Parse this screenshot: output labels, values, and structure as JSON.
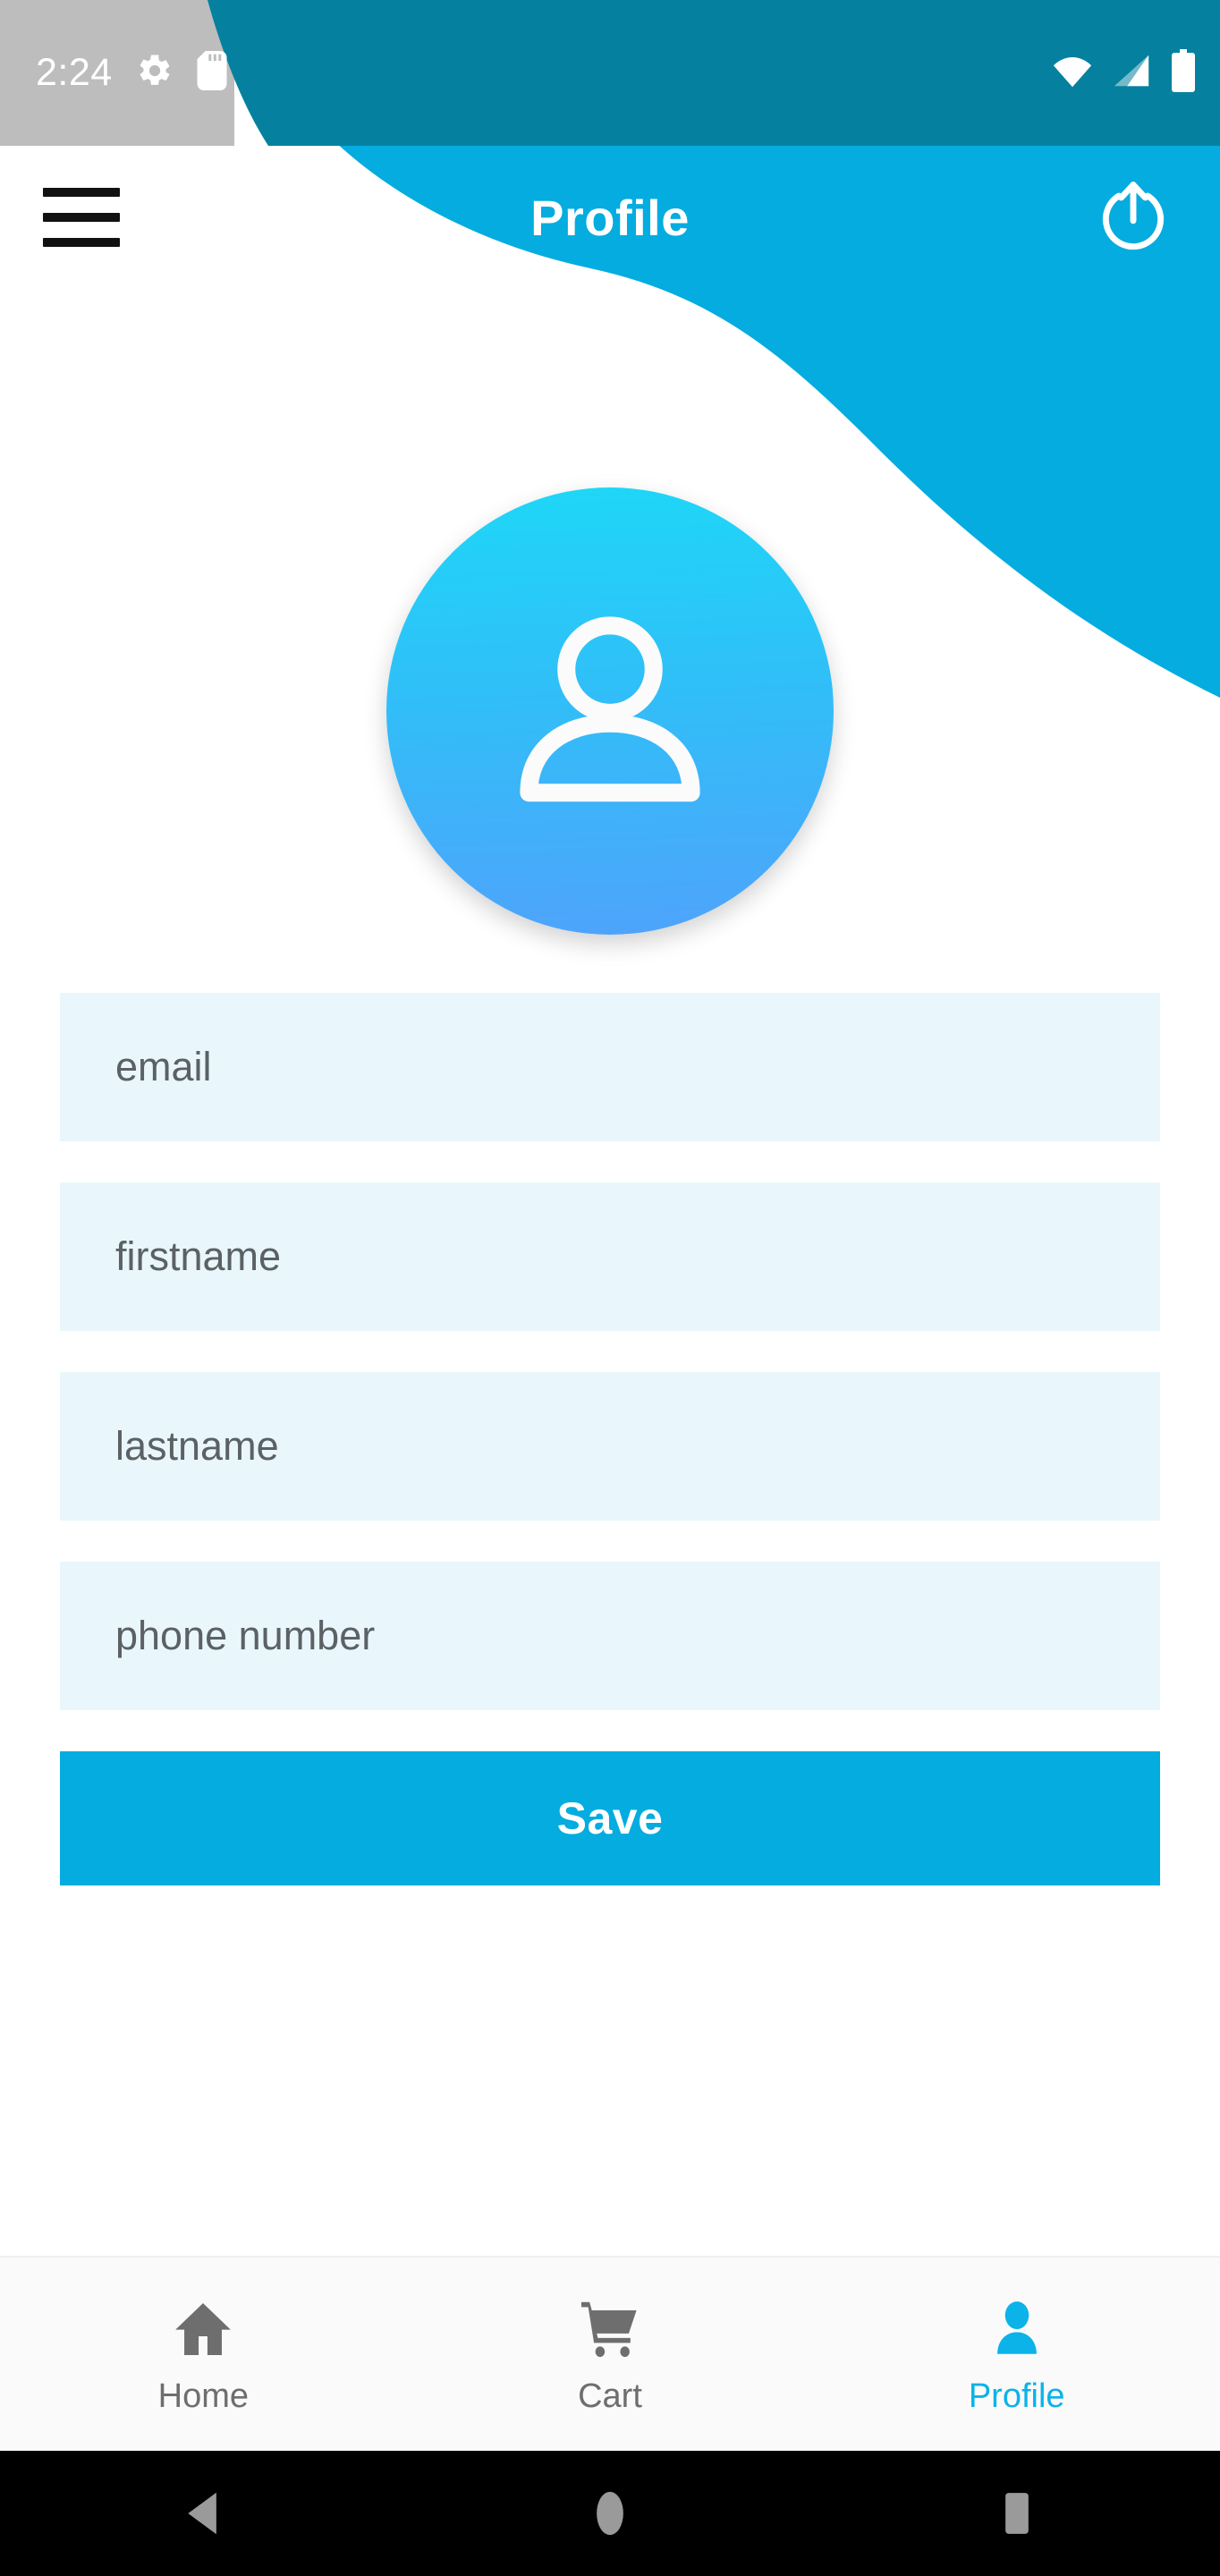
{
  "status_bar": {
    "time": "2:24",
    "left_icons": [
      "settings-gear-icon",
      "sd-card-icon"
    ],
    "right_icons": [
      "wifi-icon",
      "cellular-signal-icon",
      "battery-icon"
    ],
    "background_color": "#BDBDBD",
    "overlay_color": "#05819F"
  },
  "app_bar": {
    "menu_icon": "hamburger-menu-icon",
    "title": "Profile",
    "action_icon": "logout-icon",
    "background_color": "#04ACE0",
    "title_color": "#FFFFFF"
  },
  "avatar": {
    "icon": "user-person-icon",
    "gradient_start": "#1ED7F7",
    "gradient_end": "#4FA3FB"
  },
  "form": {
    "fields": [
      {
        "name": "email",
        "placeholder": "email",
        "value": ""
      },
      {
        "name": "firstname",
        "placeholder": "firstname",
        "value": ""
      },
      {
        "name": "lastname",
        "placeholder": "lastname",
        "value": ""
      },
      {
        "name": "phone_number",
        "placeholder": "phone number",
        "value": ""
      }
    ],
    "field_background": "#E9F7FC",
    "placeholder_color": "#5B6165",
    "save_label": "Save",
    "save_color": "#04ACE0"
  },
  "bottom_nav": {
    "active_color": "#0BB3E8",
    "inactive_color": "#6E6E6E",
    "items": [
      {
        "label": "Home",
        "icon": "home-icon",
        "active": false
      },
      {
        "label": "Cart",
        "icon": "cart-icon",
        "active": false
      },
      {
        "label": "Profile",
        "icon": "person-icon",
        "active": true
      }
    ]
  },
  "android_nav": {
    "buttons": [
      {
        "name": "back",
        "icon": "back-triangle-icon"
      },
      {
        "name": "home",
        "icon": "home-circle-icon"
      },
      {
        "name": "recents",
        "icon": "recents-square-icon"
      }
    ],
    "background_color": "#000000",
    "icon_color": "#9A9A9A"
  }
}
